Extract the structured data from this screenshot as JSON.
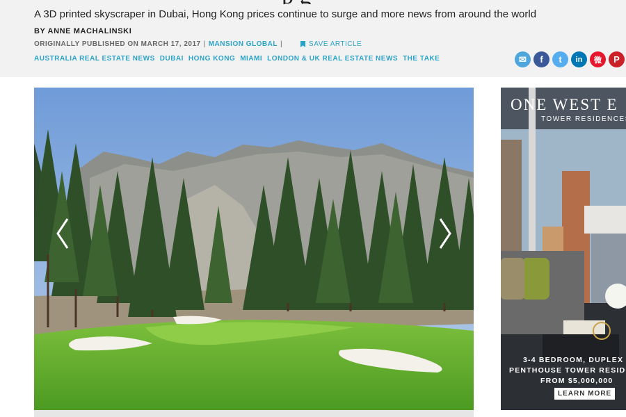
{
  "article": {
    "title_fragment": "p        g",
    "dek": "A 3D printed skyscraper in Dubai, Hong Kong prices continue to surge and more news from around the world",
    "byline": "BY ANNE MACHALINSKI",
    "published": "ORIGINALLY PUBLISHED ON MARCH 17, 2017",
    "separator": "|",
    "source": "MANSION GLOBAL",
    "save_label": "SAVE ARTICLE"
  },
  "tags": [
    "AUSTRALIA REAL ESTATE NEWS",
    "DUBAI",
    "HONG KONG",
    "MIAMI",
    "LONDON & UK REAL ESTATE NEWS",
    "THE TAKE"
  ],
  "share": [
    {
      "icon": "email-icon",
      "glyph": "✉",
      "color": "#4ea6dc"
    },
    {
      "icon": "facebook-icon",
      "glyph": "f",
      "color": "#3b5998"
    },
    {
      "icon": "twitter-icon",
      "glyph": "t",
      "color": "#55acee"
    },
    {
      "icon": "linkedin-icon",
      "glyph": "in",
      "color": "#0077b5"
    },
    {
      "icon": "weibo-icon",
      "glyph": "微",
      "color": "#e6162d"
    },
    {
      "icon": "pinterest-icon",
      "glyph": "P",
      "color": "#cb2027"
    }
  ],
  "gallery": {
    "prev_icon": "chevron-left-icon",
    "next_icon": "chevron-right-icon"
  },
  "ad": {
    "title": "ONE WEST E",
    "subtitle": "TOWER RESIDENCES",
    "line1": "3-4 BEDROOM, DUPLEX",
    "line2": "PENTHOUSE TOWER RESID",
    "line3": "FROM $5,000,000",
    "cta": "LEARN MORE"
  },
  "colors": {
    "accent": "#2aa3c9",
    "header_bg": "#f2f2f2"
  }
}
